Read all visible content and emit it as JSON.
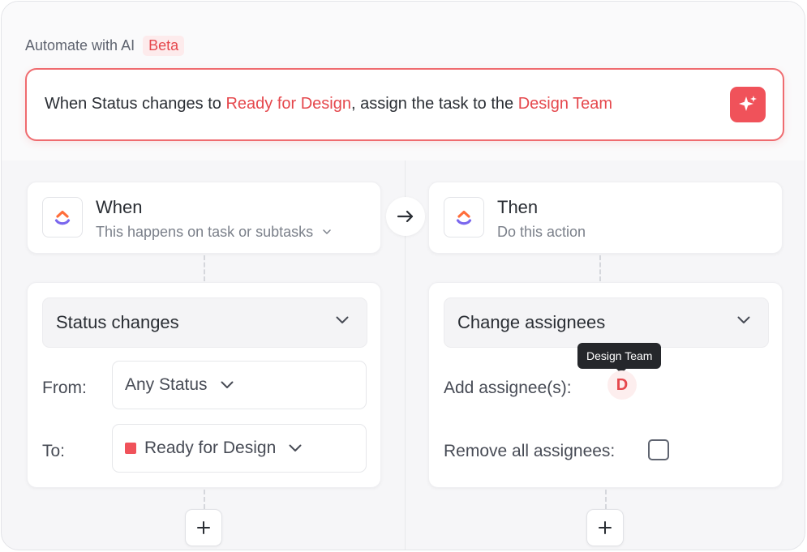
{
  "header": {
    "label": "Automate with AI",
    "badge": "Beta"
  },
  "prompt": {
    "part1": "When Status changes to ",
    "highlight1": "Ready for Design",
    "part2": ", assign the task to the ",
    "highlight2": "Design Team",
    "ai_icon": "sparkle-icon"
  },
  "trigger": {
    "title": "When",
    "subtitle": "This happens on task or subtasks",
    "logo": "clickup-logo-icon",
    "select_value": "Status changes",
    "from_label": "From:",
    "from_value": "Any Status",
    "to_label": "To:",
    "to_value": "Ready for Design",
    "to_color": "#f0525a"
  },
  "connector": {
    "icon": "arrow-right-icon"
  },
  "action": {
    "title": "Then",
    "subtitle": "Do this action",
    "logo": "clickup-logo-icon",
    "select_value": "Change assignees",
    "add_label": "Add assignee(s):",
    "tooltip": "Design Team",
    "avatar_initial": "D",
    "remove_label": "Remove all assignees:",
    "remove_checked": false
  },
  "colors": {
    "accent": "#e5484d",
    "accent_button": "#f0525a"
  }
}
